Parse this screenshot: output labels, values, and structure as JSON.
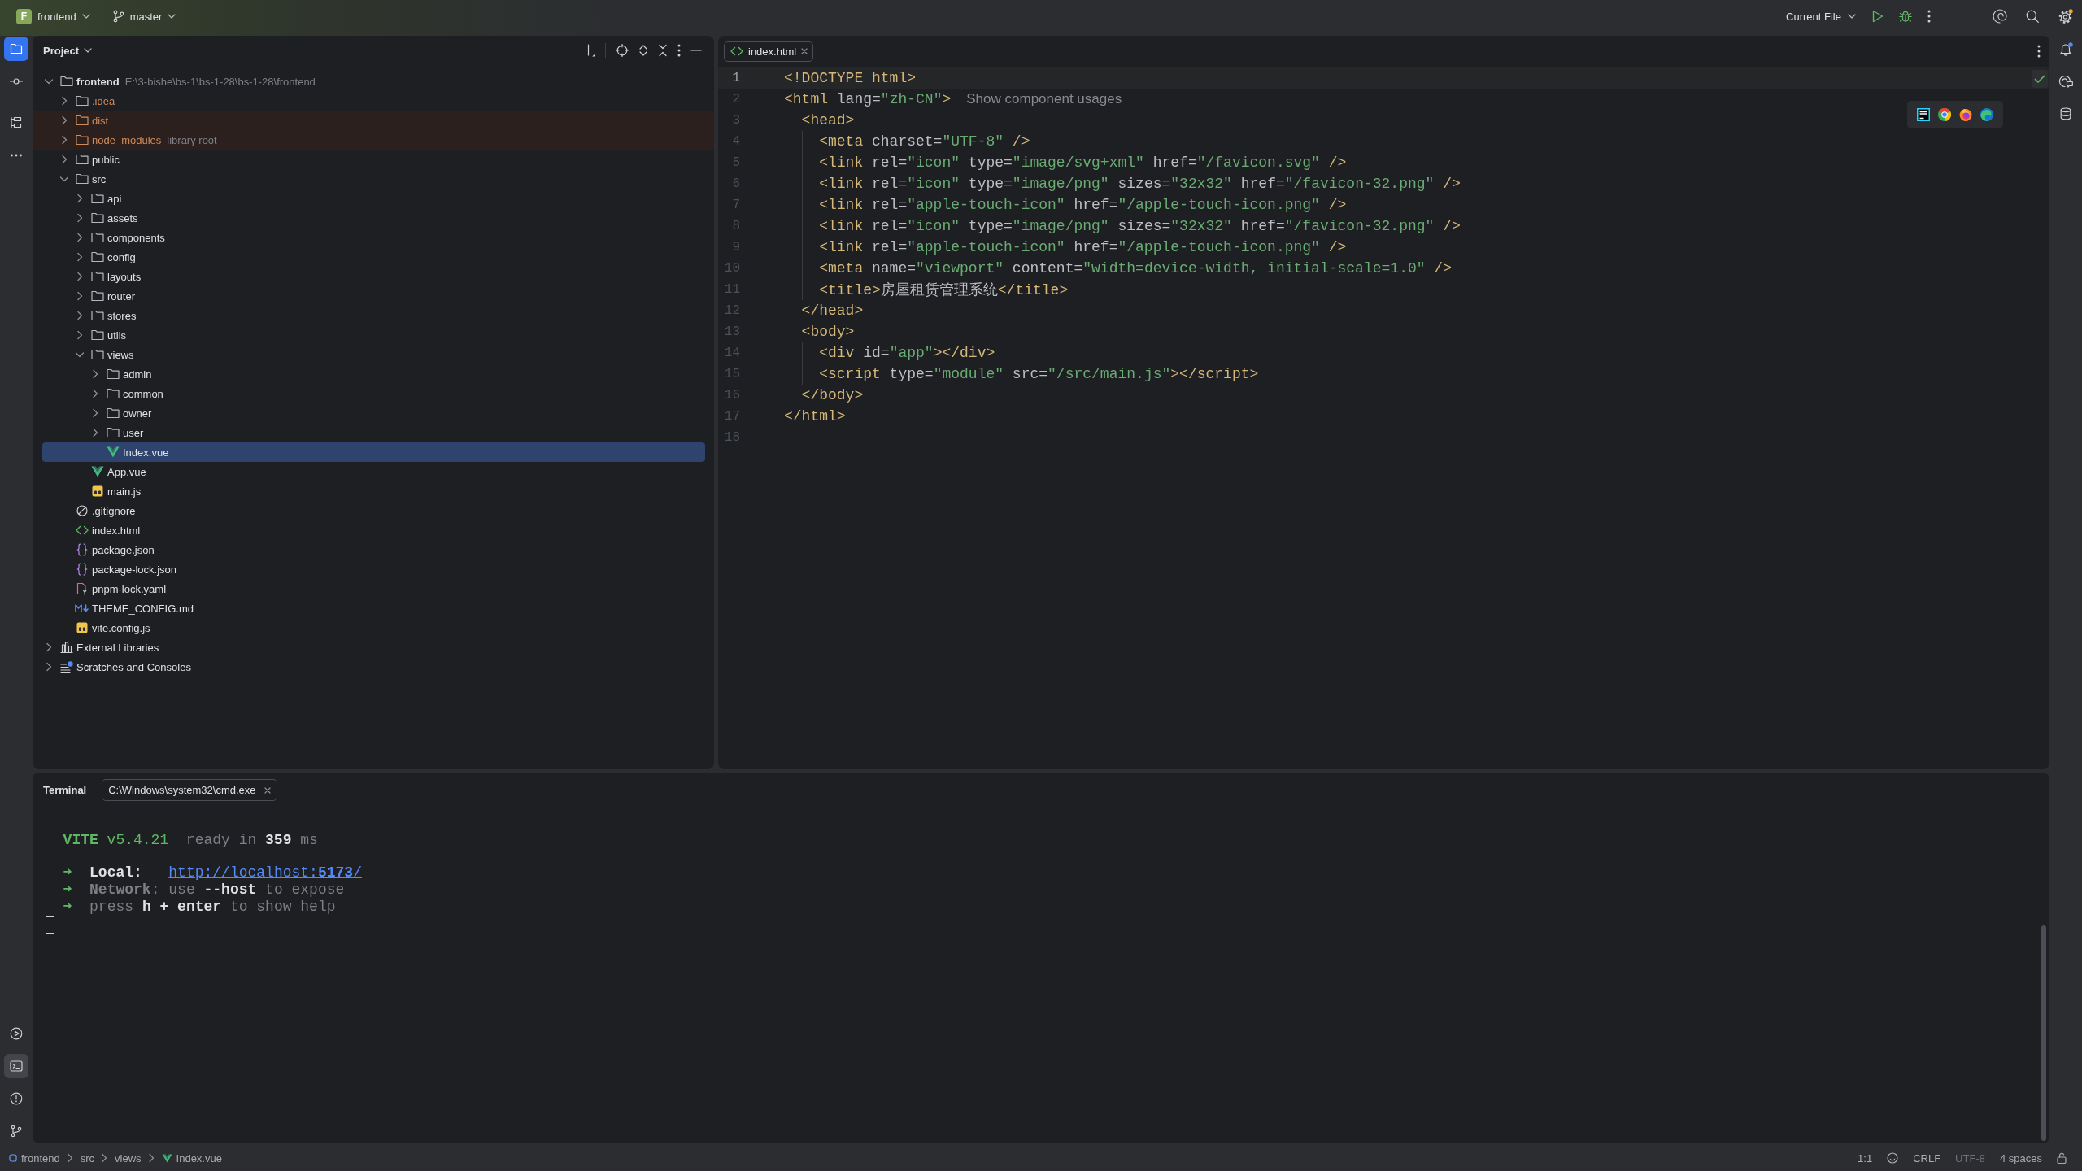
{
  "title_bar": {
    "project": {
      "badge": "F",
      "name": "frontend"
    },
    "branch": "master",
    "run_config": "Current File",
    "settings_dot": true
  },
  "left_toolbar": {
    "top": [
      {
        "kind": "project",
        "selected": true,
        "focused": true
      },
      {
        "kind": "commit",
        "selected": false
      },
      {
        "kind": "structure",
        "selected": false
      },
      {
        "kind": "more",
        "selected": false
      }
    ],
    "bottom": [
      {
        "kind": "run",
        "selected": false
      },
      {
        "kind": "terminal",
        "selected": true,
        "focused": false
      },
      {
        "kind": "problems",
        "selected": false
      },
      {
        "kind": "git",
        "selected": false
      }
    ]
  },
  "right_toolbar": {
    "notifications_dot": true
  },
  "project_panel": {
    "title": "Project",
    "tree": [
      {
        "name": "frontend",
        "kind": "module",
        "path": "E:\\3-bishe\\bs-1\\bs-1-28\\bs-1-28\\frontend",
        "expanded": true,
        "selected": false,
        "children": [
          {
            "name": ".idea",
            "kind": "folder",
            "ignored": true,
            "excluded": false,
            "expanded": false,
            "selected": false
          },
          {
            "name": "dist",
            "kind": "folder",
            "ignored": true,
            "excluded": true,
            "expanded": false,
            "selected": false
          },
          {
            "name": "node_modules",
            "kind": "folder",
            "ignored": true,
            "excluded": true,
            "suffix": "library root",
            "expanded": false,
            "selected": false
          },
          {
            "name": "public",
            "kind": "folder",
            "ignored": false,
            "excluded": false,
            "expanded": false,
            "selected": false
          },
          {
            "name": "src",
            "kind": "folder",
            "ignored": false,
            "excluded": false,
            "expanded": true,
            "selected": false,
            "children": [
              {
                "name": "api",
                "kind": "folder",
                "expanded": false,
                "selected": false
              },
              {
                "name": "assets",
                "kind": "folder",
                "expanded": false,
                "selected": false
              },
              {
                "name": "components",
                "kind": "folder",
                "expanded": false,
                "selected": false
              },
              {
                "name": "config",
                "kind": "folder",
                "expanded": false,
                "selected": false
              },
              {
                "name": "layouts",
                "kind": "folder",
                "expanded": false,
                "selected": false
              },
              {
                "name": "router",
                "kind": "folder",
                "expanded": false,
                "selected": false
              },
              {
                "name": "stores",
                "kind": "folder",
                "expanded": false,
                "selected": false
              },
              {
                "name": "utils",
                "kind": "folder",
                "expanded": false,
                "selected": false
              },
              {
                "name": "views",
                "kind": "folder",
                "expanded": true,
                "selected": false,
                "children": [
                  {
                    "name": "admin",
                    "kind": "folder",
                    "expanded": false,
                    "selected": false
                  },
                  {
                    "name": "common",
                    "kind": "folder",
                    "expanded": false,
                    "selected": false
                  },
                  {
                    "name": "owner",
                    "kind": "folder",
                    "expanded": false,
                    "selected": false
                  },
                  {
                    "name": "user",
                    "kind": "folder",
                    "expanded": false,
                    "selected": false
                  },
                  {
                    "name": "Index.vue",
                    "kind": "vue",
                    "selected": true
                  }
                ]
              },
              {
                "name": "App.vue",
                "kind": "vue",
                "selected": false
              },
              {
                "name": "main.js",
                "kind": "js",
                "selected": false
              }
            ]
          },
          {
            "name": ".gitignore",
            "kind": "gitignore",
            "ignored": false,
            "excluded": false,
            "selected": false
          },
          {
            "name": "index.html",
            "kind": "html",
            "ignored": false,
            "excluded": false,
            "selected": false
          },
          {
            "name": "package.json",
            "kind": "json",
            "ignored": false,
            "excluded": false,
            "selected": false
          },
          {
            "name": "package-lock.json",
            "kind": "json",
            "ignored": false,
            "excluded": false,
            "selected": false
          },
          {
            "name": "pnpm-lock.yaml",
            "kind": "yaml",
            "ignored": false,
            "excluded": false,
            "selected": false
          },
          {
            "name": "THEME_CONFIG.md",
            "kind": "markdown",
            "ignored": false,
            "excluded": false,
            "selected": false
          },
          {
            "name": "vite.config.js",
            "kind": "js",
            "ignored": false,
            "excluded": false,
            "selected": false
          }
        ]
      },
      {
        "name": "External Libraries",
        "kind": "libraries",
        "expanded": false,
        "selected": false
      },
      {
        "name": "Scratches and Consoles",
        "kind": "scratches",
        "expanded": false,
        "selected": false
      }
    ]
  },
  "editor": {
    "tabs": [
      {
        "label": "index.html",
        "kind": "html",
        "selected": true
      }
    ],
    "inspection_ok": true,
    "lines": [
      {
        "number": "1",
        "current": true,
        "tokens": [
          {
            "kind": "tag",
            "text": "<!DOCTYPE html>"
          }
        ]
      },
      {
        "number": "2",
        "current": false,
        "tokens": [
          {
            "kind": "tag",
            "text": "<html"
          },
          {
            "kind": "attr",
            "text": " lang="
          },
          {
            "kind": "value",
            "text": "\"zh-CN\""
          },
          {
            "kind": "tag",
            "text": ">"
          }
        ],
        "hint": "Show component usages"
      },
      {
        "number": "3",
        "current": false,
        "tokens": [
          {
            "kind": "tag",
            "text": "  <head>"
          }
        ]
      },
      {
        "number": "4",
        "current": false,
        "tokens": [
          {
            "kind": "tag",
            "text": "    <meta"
          },
          {
            "kind": "attr",
            "text": " charset="
          },
          {
            "kind": "value",
            "text": "\"UTF-8\""
          },
          {
            "kind": "tag",
            "text": " />"
          }
        ]
      },
      {
        "number": "5",
        "current": false,
        "tokens": [
          {
            "kind": "tag",
            "text": "    <link"
          },
          {
            "kind": "attr",
            "text": " rel="
          },
          {
            "kind": "value",
            "text": "\"icon\""
          },
          {
            "kind": "attr",
            "text": " type="
          },
          {
            "kind": "value",
            "text": "\"image/svg+xml\""
          },
          {
            "kind": "attr",
            "text": " href="
          },
          {
            "kind": "value",
            "text": "\"/favicon.svg\""
          },
          {
            "kind": "tag",
            "text": " />"
          }
        ]
      },
      {
        "number": "6",
        "current": false,
        "tokens": [
          {
            "kind": "tag",
            "text": "    <link"
          },
          {
            "kind": "attr",
            "text": " rel="
          },
          {
            "kind": "value",
            "text": "\"icon\""
          },
          {
            "kind": "attr",
            "text": " type="
          },
          {
            "kind": "value",
            "text": "\"image/png\""
          },
          {
            "kind": "attr",
            "text": " sizes="
          },
          {
            "kind": "value",
            "text": "\"32x32\""
          },
          {
            "kind": "attr",
            "text": " href="
          },
          {
            "kind": "value",
            "text": "\"/favicon-32.png\""
          },
          {
            "kind": "tag",
            "text": " />"
          }
        ]
      },
      {
        "number": "7",
        "current": false,
        "tokens": [
          {
            "kind": "tag",
            "text": "    <link"
          },
          {
            "kind": "attr",
            "text": " rel="
          },
          {
            "kind": "value",
            "text": "\"apple-touch-icon\""
          },
          {
            "kind": "attr",
            "text": " href="
          },
          {
            "kind": "value",
            "text": "\"/apple-touch-icon.png\""
          },
          {
            "kind": "tag",
            "text": " />"
          }
        ]
      },
      {
        "number": "8",
        "current": false,
        "tokens": [
          {
            "kind": "tag",
            "text": "    <link"
          },
          {
            "kind": "attr",
            "text": " rel="
          },
          {
            "kind": "value",
            "text": "\"icon\""
          },
          {
            "kind": "attr",
            "text": " type="
          },
          {
            "kind": "value",
            "text": "\"image/png\""
          },
          {
            "kind": "attr",
            "text": " sizes="
          },
          {
            "kind": "value",
            "text": "\"32x32\""
          },
          {
            "kind": "attr",
            "text": " href="
          },
          {
            "kind": "value",
            "text": "\"/favicon-32.png\""
          },
          {
            "kind": "tag",
            "text": " />"
          }
        ]
      },
      {
        "number": "9",
        "current": false,
        "tokens": [
          {
            "kind": "tag",
            "text": "    <link"
          },
          {
            "kind": "attr",
            "text": " rel="
          },
          {
            "kind": "value",
            "text": "\"apple-touch-icon\""
          },
          {
            "kind": "attr",
            "text": " href="
          },
          {
            "kind": "value",
            "text": "\"/apple-touch-icon.png\""
          },
          {
            "kind": "tag",
            "text": " />"
          }
        ]
      },
      {
        "number": "10",
        "current": false,
        "tokens": [
          {
            "kind": "tag",
            "text": "    <meta"
          },
          {
            "kind": "attr",
            "text": " name="
          },
          {
            "kind": "value",
            "text": "\"viewport\""
          },
          {
            "kind": "attr",
            "text": " content="
          },
          {
            "kind": "value",
            "text": "\"width=device-width, initial-scale=1.0\""
          },
          {
            "kind": "tag",
            "text": " />"
          }
        ]
      },
      {
        "number": "11",
        "current": false,
        "tokens": [
          {
            "kind": "tag",
            "text": "    <title>"
          },
          {
            "kind": "text",
            "text": "房屋租赁管理系统"
          },
          {
            "kind": "tag",
            "text": "</title>"
          }
        ]
      },
      {
        "number": "12",
        "current": false,
        "tokens": [
          {
            "kind": "tag",
            "text": "  </head>"
          }
        ]
      },
      {
        "number": "13",
        "current": false,
        "tokens": [
          {
            "kind": "tag",
            "text": "  <body>"
          }
        ]
      },
      {
        "number": "14",
        "current": false,
        "tokens": [
          {
            "kind": "tag",
            "text": "    <div"
          },
          {
            "kind": "attr",
            "text": " id="
          },
          {
            "kind": "value",
            "text": "\"app\""
          },
          {
            "kind": "tag",
            "text": "></div>"
          }
        ]
      },
      {
        "number": "15",
        "current": false,
        "tokens": [
          {
            "kind": "tag",
            "text": "    <script"
          },
          {
            "kind": "attr",
            "text": " type="
          },
          {
            "kind": "value",
            "text": "\"module\""
          },
          {
            "kind": "attr",
            "text": " src="
          },
          {
            "kind": "value",
            "text": "\"/src/main.js\""
          },
          {
            "kind": "tag",
            "text": "></script>"
          }
        ]
      },
      {
        "number": "16",
        "current": false,
        "tokens": [
          {
            "kind": "tag",
            "text": "  </body>"
          }
        ]
      },
      {
        "number": "17",
        "current": false,
        "tokens": [
          {
            "kind": "tag",
            "text": "</html>"
          }
        ]
      },
      {
        "number": "18",
        "current": false
      }
    ]
  },
  "terminal": {
    "title": "Terminal",
    "tabs": [
      {
        "label": "C:\\Windows\\system32\\cmd.exe",
        "selected": true
      }
    ],
    "blocks": [
      [
        [
          {
            "kind": "brand",
            "text": "  VITE"
          },
          {
            "kind": "version",
            "text": " v5.4.21"
          },
          {
            "kind": "dim",
            "text": "  ready in "
          },
          {
            "kind": "strong",
            "text": "359"
          },
          {
            "kind": "dim",
            "text": " ms"
          }
        ]
      ],
      [
        [
          {
            "kind": "arrow",
            "text": "  ➜"
          },
          {
            "kind": "strong",
            "text": "  Local:   "
          },
          {
            "kind": "link",
            "text": "http://localhost:**5173**/"
          }
        ],
        [
          {
            "kind": "arrow",
            "text": "  ➜"
          },
          {
            "kind": "label_dim",
            "text": "  Network"
          },
          {
            "kind": "dim",
            "text": ": use "
          },
          {
            "kind": "strong",
            "text": "--host"
          },
          {
            "kind": "dim",
            "text": " to expose"
          }
        ],
        [
          {
            "kind": "arrow",
            "text": "  ➜"
          },
          {
            "kind": "dim",
            "text": "  press "
          },
          {
            "kind": "strong",
            "text": "h + enter"
          },
          {
            "kind": "dim",
            "text": " to show help"
          }
        ]
      ]
    ]
  },
  "status_bar": {
    "breadcrumbs": [
      {
        "label": "frontend",
        "kind": "module"
      },
      {
        "label": "src",
        "kind": "folder"
      },
      {
        "label": "views",
        "kind": "folder"
      },
      {
        "label": "Index.vue",
        "kind": "vue"
      }
    ],
    "widgets": [
      {
        "label": "1:1",
        "disabled": false
      },
      {
        "label": "CRLF",
        "disabled": false
      },
      {
        "label": "UTF-8",
        "disabled": true
      },
      {
        "label": "4 spaces",
        "disabled": false
      }
    ]
  }
}
